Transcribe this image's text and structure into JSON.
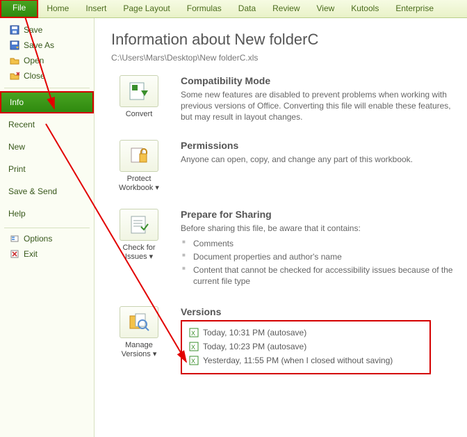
{
  "ribbon": {
    "file": "File",
    "tabs": [
      "Home",
      "Insert",
      "Page Layout",
      "Formulas",
      "Data",
      "Review",
      "View",
      "Kutools",
      "Enterprise"
    ]
  },
  "nav": {
    "top": [
      {
        "label": "Save",
        "icon": "save-icon"
      },
      {
        "label": "Save As",
        "icon": "saveas-icon"
      },
      {
        "label": "Open",
        "icon": "open-icon"
      },
      {
        "label": "Close",
        "icon": "close-icon"
      }
    ],
    "middle": [
      "Info",
      "Recent",
      "New",
      "Print",
      "Save & Send",
      "Help"
    ],
    "selected": "Info",
    "bottom": [
      {
        "label": "Options",
        "icon": "options-icon"
      },
      {
        "label": "Exit",
        "icon": "exit-icon"
      }
    ]
  },
  "page": {
    "title": "Information about New folderC",
    "path": "C:\\Users\\Mars\\Desktop\\New folderC.xls"
  },
  "sections": {
    "compat": {
      "button": "Convert",
      "heading": "Compatibility Mode",
      "body": "Some new features are disabled to prevent problems when working with previous versions of Office. Converting this file will enable these features, but may result in layout changes."
    },
    "perm": {
      "button": "Protect Workbook ▾",
      "heading": "Permissions",
      "body": "Anyone can open, copy, and change any part of this workbook."
    },
    "prepare": {
      "button": "Check for Issues ▾",
      "heading": "Prepare for Sharing",
      "body": "Before sharing this file, be aware that it contains:",
      "items": [
        "Comments",
        "Document properties and author's name",
        "Content that cannot be checked for accessibility issues because of the current file type"
      ]
    },
    "versions": {
      "button": "Manage Versions ▾",
      "heading": "Versions",
      "items": [
        "Today, 10:31 PM (autosave)",
        "Today, 10:23 PM (autosave)",
        "Yesterday, 11:55 PM (when I closed without saving)"
      ]
    }
  }
}
